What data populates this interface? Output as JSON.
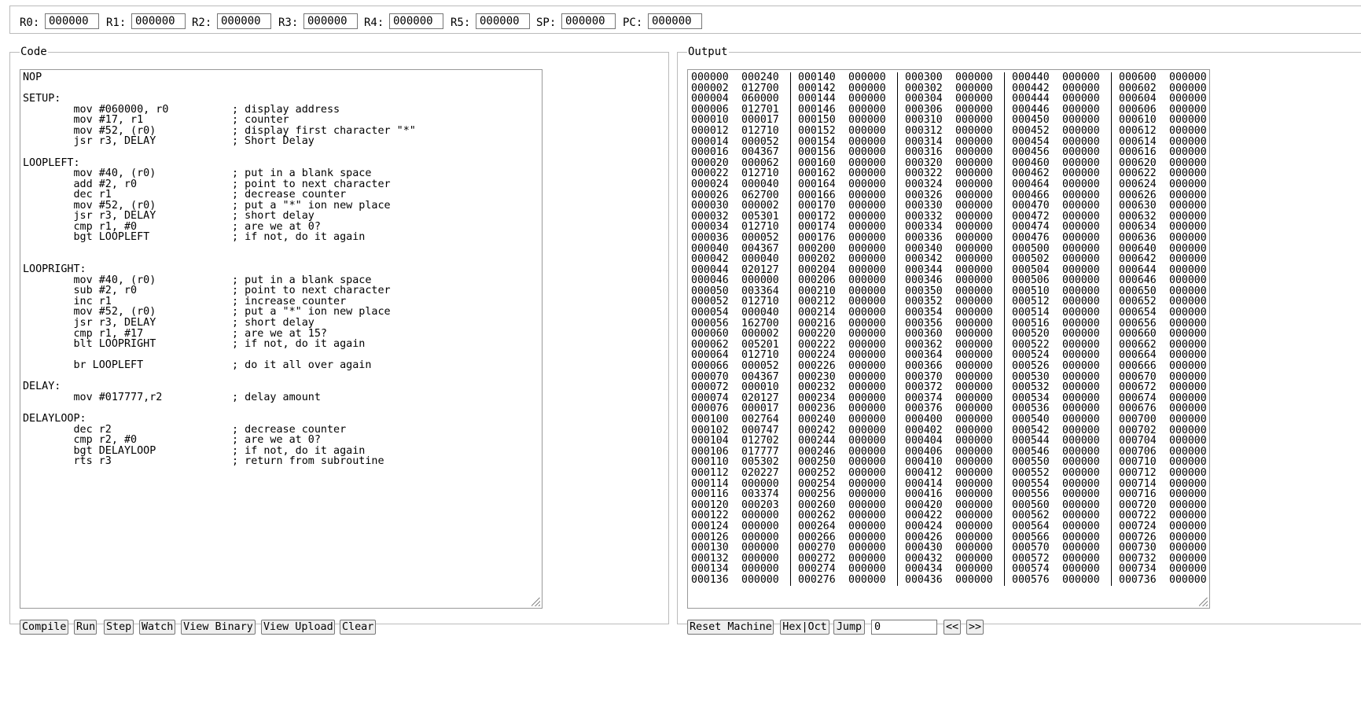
{
  "registers": [
    {
      "label": "R0:",
      "value": "000000"
    },
    {
      "label": "R1:",
      "value": "000000"
    },
    {
      "label": "R2:",
      "value": "000000"
    },
    {
      "label": "R3:",
      "value": "000000"
    },
    {
      "label": "R4:",
      "value": "000000"
    },
    {
      "label": "R5:",
      "value": "000000"
    },
    {
      "label": "SP:",
      "value": "000000"
    },
    {
      "label": "PC:",
      "value": "000000"
    }
  ],
  "code_panel": {
    "legend": "Code",
    "source": "NOP\n\nSETUP:\n        mov #060000, r0          ; display address\n        mov #17, r1              ; counter\n        mov #52, (r0)            ; display first character \"*\"\n        jsr r3, DELAY            ; Short Delay\n\nLOOPLEFT:\n        mov #40, (r0)            ; put in a blank space\n        add #2, r0               ; point to next character\n        dec r1                   ; decrease counter\n        mov #52, (r0)            ; put a \"*\" ion new place\n        jsr r3, DELAY            ; short delay\n        cmp r1, #0               ; are we at 0?\n        bgt LOOPLEFT             ; if not, do it again\n\n\nLOOPRIGHT:\n        mov #40, (r0)            ; put in a blank space\n        sub #2, r0               ; point to next character\n        inc r1                   ; increase counter\n        mov #52, (r0)            ; put a \"*\" ion new place\n        jsr r3, DELAY            ; short delay\n        cmp r1, #17              ; are we at 15?\n        blt LOOPRIGHT            ; if not, do it again\n\n        br LOOPLEFT              ; do it all over again\n\nDELAY:\n        mov #017777,r2           ; delay amount\n\nDELAYLOOP:\n        dec r2                   ; decrease counter\n        cmp r2, #0               ; are we at 0?\n        bgt DELAYLOOP            ; if not, do it again\n        rts r3                   ; return from subroutine",
    "buttons": [
      "Compile",
      "Run",
      "Step",
      "Watch",
      "View Binary",
      "View Upload",
      "Clear"
    ]
  },
  "output_panel": {
    "legend": "Output",
    "col1_values": [
      "000240",
      "012700",
      "060000",
      "012701",
      "000017",
      "012710",
      "000052",
      "004367",
      "000062",
      "012710",
      "000040",
      "062700",
      "000002",
      "005301",
      "012710",
      "000052",
      "004367",
      "000040",
      "020127",
      "000000",
      "003364",
      "012710",
      "000040",
      "162700",
      "000002",
      "005201",
      "012710",
      "000052",
      "004367",
      "000010",
      "020127",
      "000017",
      "002764",
      "000747",
      "012702",
      "017777",
      "005302",
      "020227",
      "000000",
      "003374",
      "000203",
      "000000",
      "000000",
      "000000",
      "000000",
      "000000",
      "000000",
      "000000"
    ],
    "buttons": [
      "Reset Machine",
      "Hex|Oct",
      "Jump"
    ],
    "jump_value": "0",
    "prev_label": "<<",
    "next_label": ">>"
  }
}
